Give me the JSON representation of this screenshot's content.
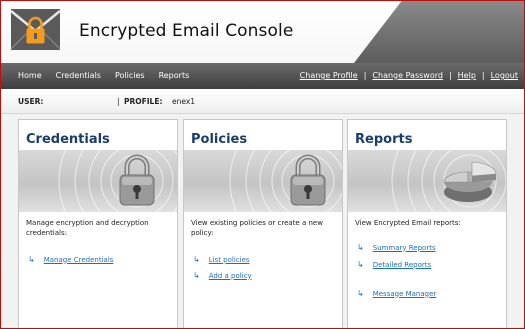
{
  "header": {
    "title": "Encrypted Email Console",
    "logo_icon": "lock-envelope-icon"
  },
  "nav": {
    "left": [
      "Home",
      "Credentials",
      "Policies",
      "Reports"
    ],
    "right": [
      "Change Profile",
      "Change Password",
      "Help",
      "Logout"
    ],
    "separator": "|"
  },
  "userbar": {
    "user_label": "USER:",
    "user_value": "",
    "separator": "|",
    "profile_label": "PROFILE:",
    "profile_value": "enex1"
  },
  "panels": [
    {
      "title": "Credentials",
      "icon": "padlock-icon",
      "description": "Manage encryption and decryption credentials:",
      "links": [
        "Manage Credentials"
      ]
    },
    {
      "title": "Policies",
      "icon": "padlock-icon",
      "description": "View existing policies or create a new policy:",
      "links": [
        "List policies",
        "Add a policy"
      ]
    },
    {
      "title": "Reports",
      "icon": "pie-chart-icon",
      "description": "View Encrypted Email reports:",
      "links": [
        "Summary Reports",
        "Detailed Reports",
        "Message Manager"
      ]
    }
  ],
  "colors": {
    "accent_blue": "#1a3d6e",
    "link_blue": "#1c6fbf",
    "frame_red": "#b80f0f",
    "logo_orange": "#f39c1b"
  }
}
